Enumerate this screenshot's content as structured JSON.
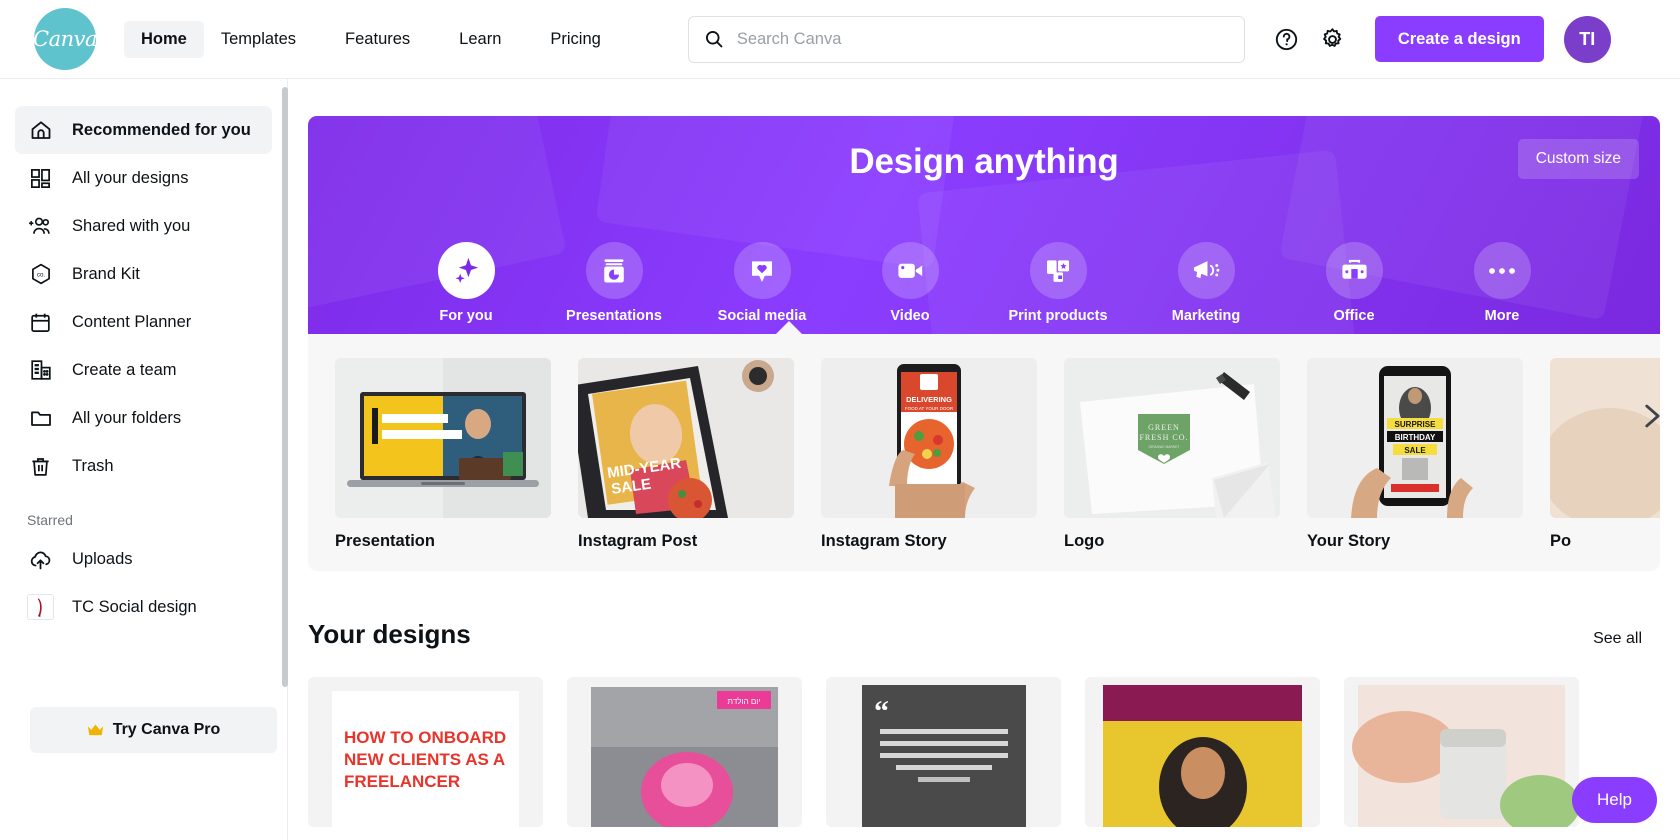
{
  "header": {
    "logo_text": "Canva",
    "nav": [
      {
        "label": "Home",
        "has_caret": false,
        "active": true
      },
      {
        "label": "Templates",
        "has_caret": true,
        "active": false
      },
      {
        "label": "Features",
        "has_caret": true,
        "active": false
      },
      {
        "label": "Learn",
        "has_caret": true,
        "active": false
      },
      {
        "label": "Pricing",
        "has_caret": true,
        "active": false
      }
    ],
    "search": {
      "value": "",
      "placeholder": "Search Canva",
      "icon": "search-icon"
    },
    "help_icon": "question-circle-icon",
    "settings_icon": "gear-icon",
    "create_button": "Create a design",
    "avatar_initials": "TI"
  },
  "sidebar": {
    "items": [
      {
        "label": "Recommended for you",
        "icon": "home-icon",
        "active": true
      },
      {
        "label": "All your designs",
        "icon": "grid-icon",
        "active": false
      },
      {
        "label": "Shared with you",
        "icon": "add-people-icon",
        "active": false
      },
      {
        "label": "Brand Kit",
        "icon": "brand-hexagon-icon",
        "active": false
      },
      {
        "label": "Content Planner",
        "icon": "calendar-icon",
        "active": false
      },
      {
        "label": "Create a team",
        "icon": "building-icon",
        "active": false
      },
      {
        "label": "All your folders",
        "icon": "folder-icon",
        "active": false
      },
      {
        "label": "Trash",
        "icon": "trash-icon",
        "active": false
      }
    ],
    "section_label": "Starred",
    "starred": [
      {
        "label": "Uploads",
        "icon": "cloud-upload-icon"
      },
      {
        "label": "TC Social design",
        "icon": "design-thumbnail-icon"
      }
    ],
    "pro_button": {
      "label": "Try Canva Pro",
      "icon": "crown-icon"
    }
  },
  "hero": {
    "title": "Design anything",
    "custom_size_button": "Custom size",
    "categories": [
      {
        "label": "For you",
        "icon": "sparkle-icon",
        "selected": true
      },
      {
        "label": "Presentations",
        "icon": "presentation-chart-icon",
        "selected": false
      },
      {
        "label": "Social media",
        "icon": "heart-pin-icon",
        "selected": false
      },
      {
        "label": "Video",
        "icon": "video-camera-icon",
        "selected": false
      },
      {
        "label": "Print products",
        "icon": "print-products-icon",
        "selected": false
      },
      {
        "label": "Marketing",
        "icon": "megaphone-icon",
        "selected": false
      },
      {
        "label": "Office",
        "icon": "briefcase-icon",
        "selected": false
      },
      {
        "label": "More",
        "icon": "ellipsis-icon",
        "selected": false
      }
    ]
  },
  "templates": [
    {
      "label": "Presentation",
      "thumb": "laptop-presentation-thumb"
    },
    {
      "label": "Instagram Post",
      "thumb": "phone-midyear-sale-thumb"
    },
    {
      "label": "Instagram Story",
      "thumb": "phone-delivering-food-thumb"
    },
    {
      "label": "Logo",
      "thumb": "envelope-green-fresh-thumb"
    },
    {
      "label": "Your Story",
      "thumb": "phone-birthday-sale-thumb"
    },
    {
      "label": "Po",
      "thumb": "partial-card-thumb"
    }
  ],
  "your_designs": {
    "title": "Your designs",
    "see_all": "See all",
    "items": [
      {
        "thumb": "how-to-onboard-doc",
        "text": "HOW TO ONBOARD NEW CLIENTS AS A"
      },
      {
        "thumb": "pink-flower-post"
      },
      {
        "thumb": "dark-quote-card"
      },
      {
        "thumb": "yellow-portrait-card"
      },
      {
        "thumb": "hands-product-card"
      }
    ]
  },
  "help_button": "Help",
  "colors": {
    "brand_teal": "#5fc3ce",
    "accent_purple": "#8b3dff",
    "hero_purple": "#7d2ae8",
    "panel_bg": "#f7f7f8",
    "active_bg": "#f2f3f4",
    "text": "#0d1216",
    "muted": "#6e7479"
  }
}
